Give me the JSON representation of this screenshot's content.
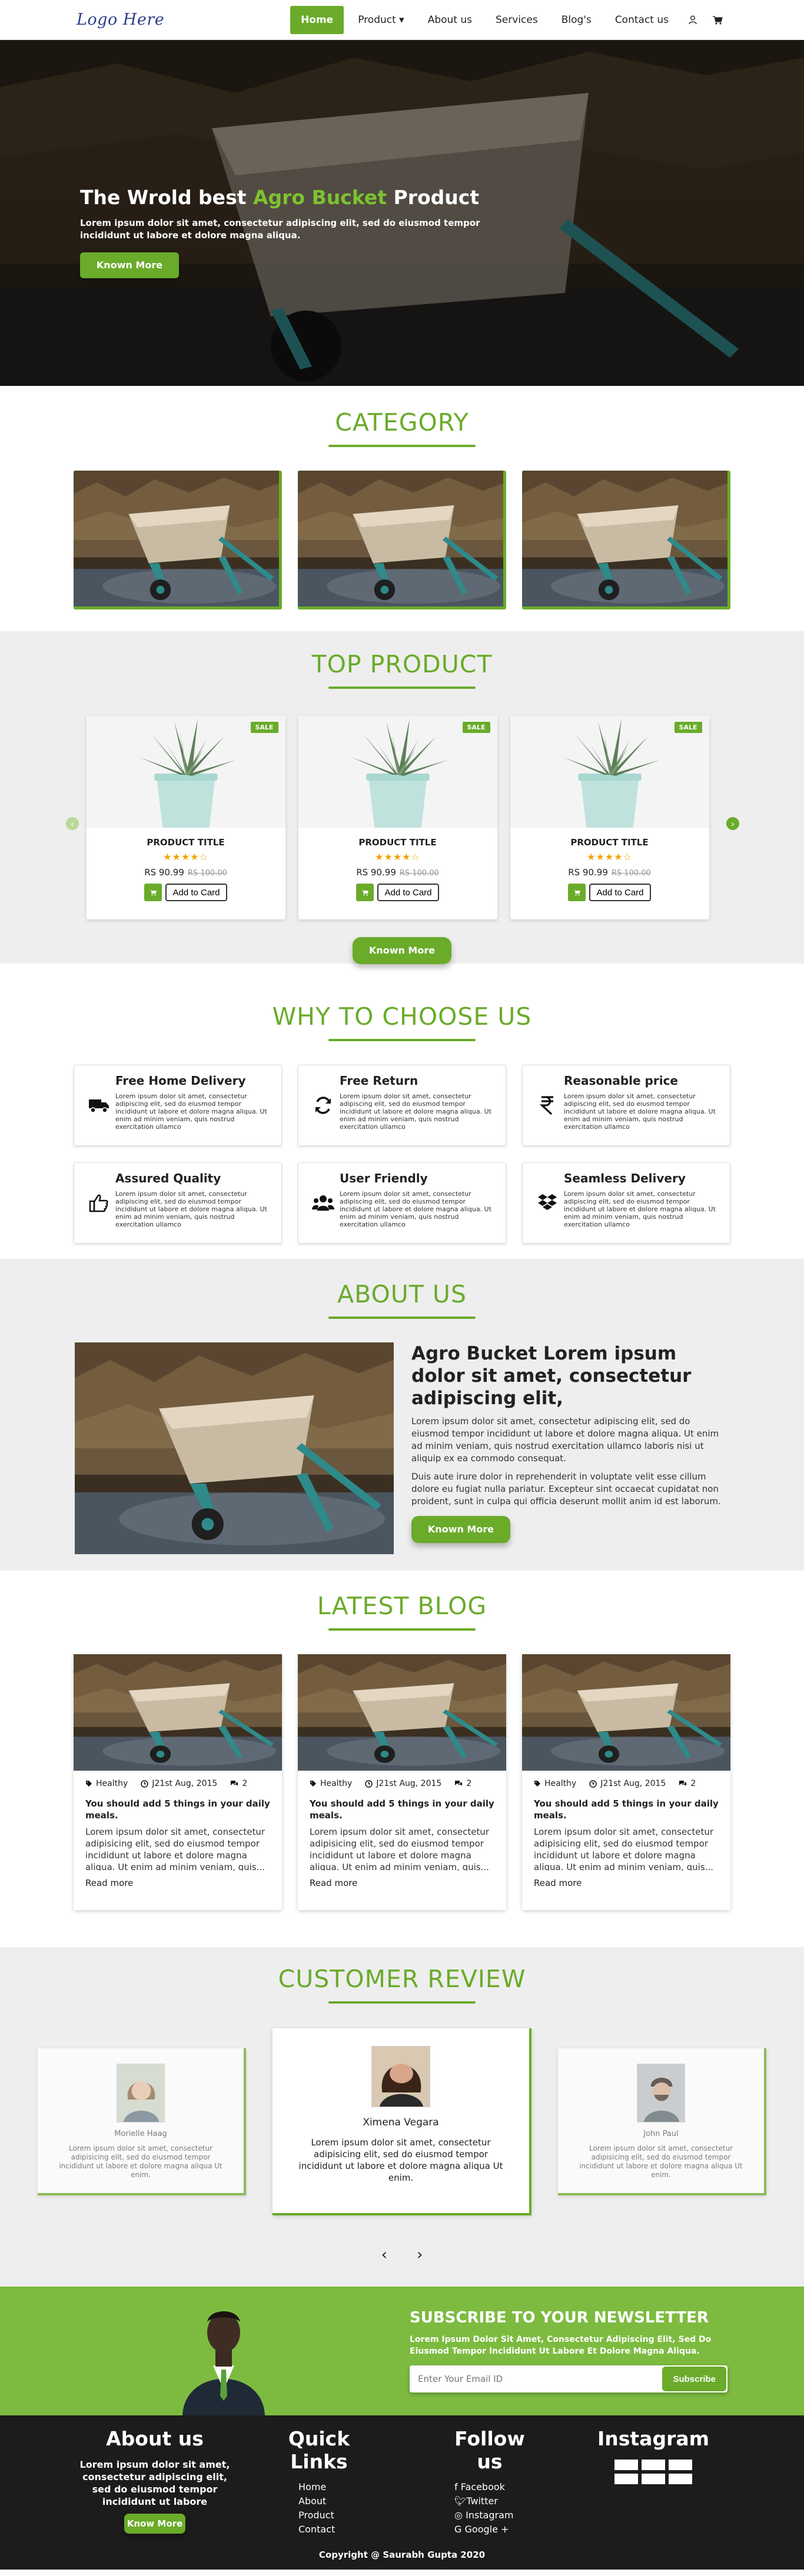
{
  "nav": {
    "logo": "Logo Here",
    "items": [
      {
        "label": "Home",
        "active": true
      },
      {
        "label": "Product"
      },
      {
        "label": "About us"
      },
      {
        "label": "Services"
      },
      {
        "label": "Blog's"
      },
      {
        "label": "Contact us"
      }
    ],
    "dropdown_caret": "▾"
  },
  "hero": {
    "title_pre": "The Wrold best ",
    "title_accent": "Agro Bucket",
    "title_post": " Product",
    "text": "Lorem ipsum dolor sit amet, consectetur adipiscing elit, sed do eiusmod tempor incididunt ut labore et dolore magna aliqua.",
    "button": "Known More"
  },
  "category": {
    "title": "CATEGORY"
  },
  "top_product": {
    "title": "TOP PRODUCT",
    "products": [
      {
        "badge": "SALE",
        "title": "PRODUCT TITLE",
        "stars": "★★★★☆",
        "price": "RS 90.99",
        "old_price": "RS 100.00",
        "button": "Add to Card"
      },
      {
        "badge": "SALE",
        "title": "PRODUCT TITLE",
        "stars": "★★★★☆",
        "price": "RS 90.99",
        "old_price": "RS 100.00",
        "button": "Add to Card"
      },
      {
        "badge": "SALE",
        "title": "PRODUCT TITLE",
        "stars": "★★★★☆",
        "price": "RS 90.99",
        "old_price": "RS 100.00",
        "button": "Add to Card"
      }
    ],
    "button": "Known More",
    "arrow_left": "‹",
    "arrow_right": "›"
  },
  "why": {
    "title": "WHY TO CHOOSE US",
    "cards": [
      {
        "title": "Free Home Delivery",
        "icon": "truck-icon",
        "text": "Lorem ipsum dolor sit amet, consectetur adipiscing elit, sed do eiusmod tempor incididunt ut labore et dolore magna aliqua. Ut enim ad minim veniam, quis nostrud exercitation ullamco"
      },
      {
        "title": "Free Return",
        "icon": "refresh-icon",
        "text": "Lorem ipsum dolor sit amet, consectetur adipiscing elit, sed do eiusmod tempor incididunt ut labore et dolore magna aliqua. Ut enim ad minim veniam, quis nostrud exercitation ullamco"
      },
      {
        "title": "Reasonable price",
        "icon": "rupee-icon",
        "text": "Lorem ipsum dolor sit amet, consectetur adipiscing elit, sed do eiusmod tempor incididunt ut labore et dolore magna aliqua. Ut enim ad minim veniam, quis nostrud exercitation ullamco"
      },
      {
        "title": "Assured Quality",
        "icon": "thumbs-up-icon",
        "text": "Lorem ipsum dolor sit amet, consectetur adipiscing elit, sed do eiusmod tempor incididunt ut labore et dolore magna aliqua. Ut enim ad minim veniam, quis nostrud exercitation ullamco"
      },
      {
        "title": "User Friendly",
        "icon": "users-icon",
        "text": "Lorem ipsum dolor sit amet, consectetur adipiscing elit, sed do eiusmod tempor incididunt ut labore et dolore magna aliqua. Ut enim ad minim veniam, quis nostrud exercitation ullamco"
      },
      {
        "title": "Seamless Delivery",
        "icon": "dropbox-icon",
        "text": "Lorem ipsum dolor sit amet, consectetur adipiscing elit, sed do eiusmod tempor incididunt ut labore et dolore magna aliqua. Ut enim ad minim veniam, quis nostrud exercitation ullamco"
      }
    ]
  },
  "about": {
    "title": "ABOUT US",
    "heading": "Agro Bucket Lorem ipsum dolor sit amet, consectetur adipiscing elit,",
    "p1": "Lorem ipsum dolor sit amet, consectetur adipiscing elit, sed do eiusmod tempor incididunt ut labore et dolore magna aliqua. Ut enim ad minim veniam, quis nostrud exercitation ullamco laboris nisi ut aliquip ex ea commodo consequat.",
    "p2": "Duis aute irure dolor in reprehenderit in voluptate velit esse cillum dolore eu fugiat nulla pariatur. Excepteur sint occaecat cupidatat non proident, sunt in culpa qui officia deserunt mollit anim id est laborum.",
    "button": "Known More"
  },
  "blog": {
    "title": "LATEST BLOG",
    "posts": [
      {
        "tag": "Healthy",
        "date": "J21st Aug, 2015",
        "comments": "2",
        "title": "You should add 5 things in your daily meals.",
        "text": "Lorem ipsum dolor sit amet, consectetur adipisicing elit, sed do eiusmod tempor incididunt ut labore et dolore magna aliqua. Ut enim ad minim veniam, quis...",
        "read": "Read more"
      },
      {
        "tag": "Healthy",
        "date": "J21st Aug, 2015",
        "comments": "2",
        "title": "You should add 5 things in your daily meals.",
        "text": "Lorem ipsum dolor sit amet, consectetur adipisicing elit, sed do eiusmod tempor incididunt ut labore et dolore magna aliqua. Ut enim ad minim veniam, quis...",
        "read": "Read more"
      },
      {
        "tag": "Healthy",
        "date": "J21st Aug, 2015",
        "comments": "2",
        "title": "You should add 5 things in your daily meals.",
        "text": "Lorem ipsum dolor sit amet, consectetur adipisicing elit, sed do eiusmod tempor incididunt ut labore et dolore magna aliqua. Ut enim ad minim veniam, quis...",
        "read": "Read more"
      }
    ]
  },
  "review": {
    "title": "CUSTOMER REVIEW",
    "items": [
      {
        "name": "Morielle Haag",
        "text": "Lorem ipsum dolor sit amet, consectetur adipisicing elit, sed do eiusmod tempor incididunt ut labore et dolore magna aliqua Ut enim."
      },
      {
        "name": "Ximena Vegara",
        "text": "Lorem ipsum dolor sit amet, consectetur adipisicing elit, sed do eiusmod tempor incididunt ut labore et dolore magna aliqua Ut enim."
      },
      {
        "name": "John Paul",
        "text": "Lorem ipsum dolor sit amet, consectetur adipisicing elit, sed do eiusmod tempor incididunt ut labore et dolore magna aliqua Ut enim."
      }
    ],
    "prev": "‹",
    "next": "›"
  },
  "newsletter": {
    "title": "SUBSCRIBE TO YOUR NEWSLETTER",
    "text": "Lorem Ipsum Dolor Sit Amet, Consectetur Adipiscing Elit, Sed Do Eiusmod Tempor Incididunt Ut Labore Et Dolore Magna Aliqua.",
    "placeholder": "Enter Your Email ID",
    "button": "Subscribe"
  },
  "footer": {
    "about_title": "About us",
    "about_text": "Lorem ipsum dolor sit amet, consectetur adipiscing elit, sed do eiusmod tempor incididunt ut labore",
    "about_button": "Know More",
    "quick_title": "Quick Links",
    "quick_links": [
      "Home",
      "About",
      "Product",
      "Contact"
    ],
    "follow_title": "Follow us",
    "social": [
      {
        "icon": "facebook-icon",
        "label": "Facebook"
      },
      {
        "icon": "twitter-icon",
        "label": "Twitter"
      },
      {
        "icon": "instagram-icon",
        "label": "Instagram"
      },
      {
        "icon": "google-plus-icon",
        "label": "Google +"
      }
    ],
    "insta_title": "Instagram",
    "copyright": "Copyright @ Saurabh Gupta 2020"
  },
  "colors": {
    "accent": "#6aab2a",
    "accent_light": "#7dbb40",
    "footer_bg": "#1c1c1c",
    "section_gray": "#eeeeee"
  }
}
